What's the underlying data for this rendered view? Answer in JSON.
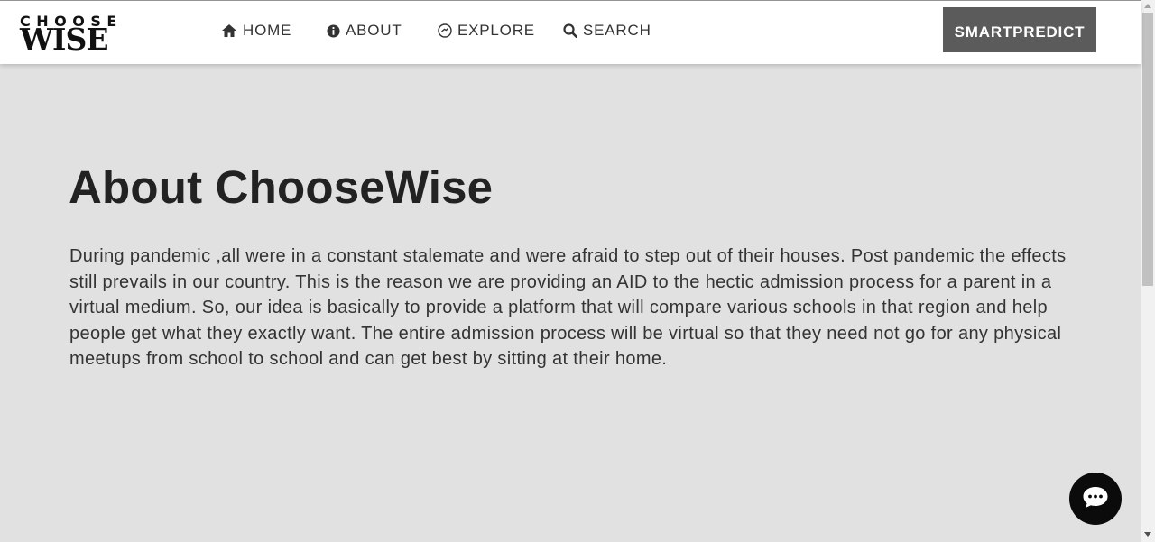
{
  "brand": {
    "logo_top": "CHOOSE",
    "logo_bottom": "WISE"
  },
  "nav": {
    "items": [
      {
        "label": "HOME",
        "icon": "home-icon"
      },
      {
        "label": "ABOUT",
        "icon": "info-icon"
      },
      {
        "label": "EXPLORE",
        "icon": "compass-icon"
      },
      {
        "label": "SEARCH",
        "icon": "search-icon"
      }
    ],
    "cta_label": "SMARTPREDICT"
  },
  "main": {
    "title": "About ChooseWise",
    "body": "During pandemic ,all were in a constant stalemate and were afraid to step out of their houses. Post pandemic the effects still prevails in our country. This is the reason we are providing an AID to the hectic admission process for a parent in a virtual medium. So, our idea is basically to provide a platform that will compare various schools in that region and help people get what they exactly want. The entire admission process will be virtual so that they need not go for any physical meetups from school to school and can get best by sitting at their home."
  },
  "chat_widget": {
    "icon": "chat-bubble-icon"
  },
  "colors": {
    "page_bg": "#e1e1e1",
    "navbar_bg": "#ffffff",
    "cta_bg": "#5b5b5b",
    "chat_bg": "#0b0b0b",
    "text": "#333333"
  }
}
